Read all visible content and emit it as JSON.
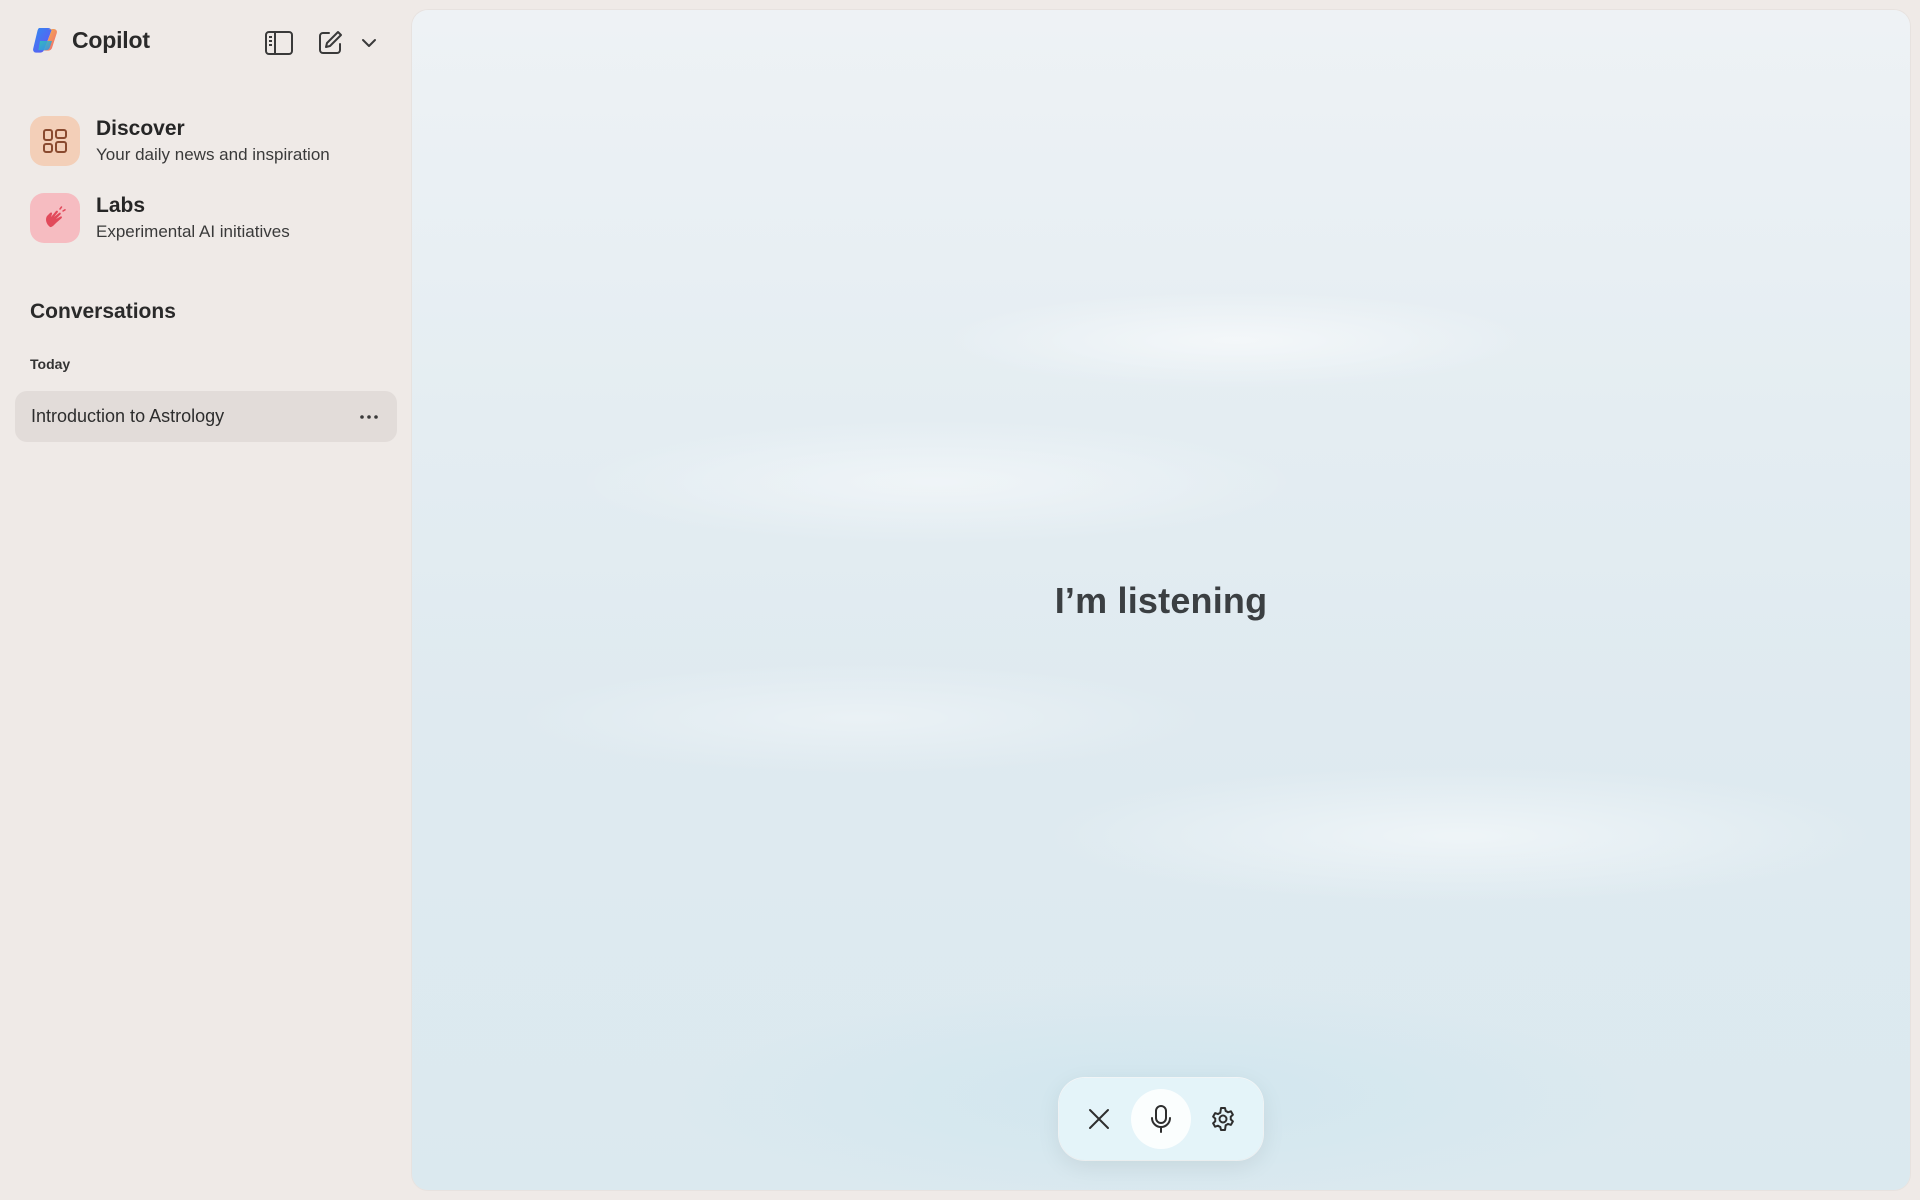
{
  "app": {
    "name": "Copilot"
  },
  "sidebar": {
    "features": [
      {
        "title": "Discover",
        "subtitle": "Your daily news and inspiration",
        "icon": "grid-icon",
        "color": "#f3cfb8"
      },
      {
        "title": "Labs",
        "subtitle": "Experimental AI initiatives",
        "icon": "hand-icon",
        "color": "#f6bcc1"
      }
    ],
    "conversations_title": "Conversations",
    "groups": [
      {
        "label": "Today",
        "items": [
          {
            "title": "Introduction to Astrology",
            "selected": true
          }
        ]
      }
    ]
  },
  "main": {
    "status_text": "I’m listening"
  },
  "voice_controls": {
    "buttons": [
      "close-icon",
      "microphone-icon",
      "settings-icon"
    ]
  }
}
